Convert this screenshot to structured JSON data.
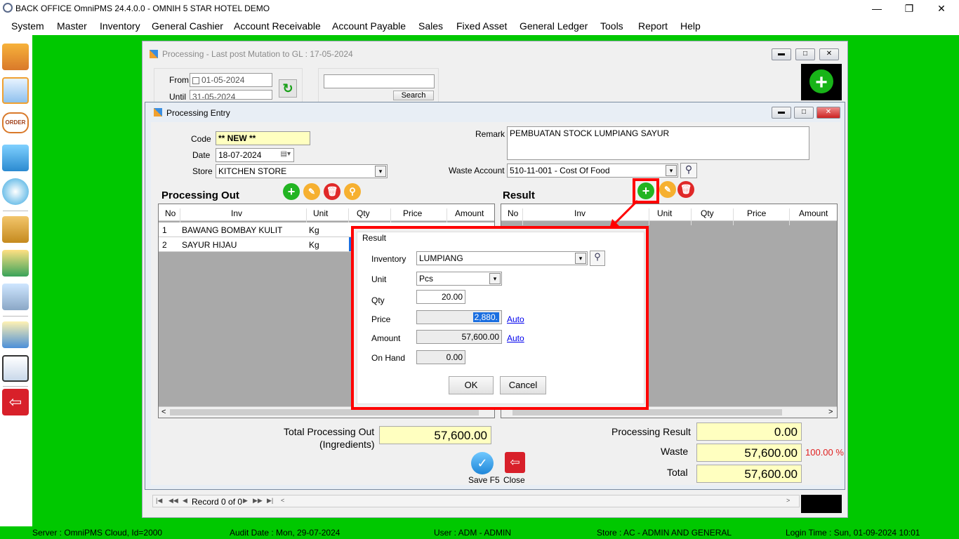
{
  "app": {
    "title": "BACK OFFICE OmniPMS 24.4.0.0 - OMNIH 5 STAR HOTEL DEMO",
    "menu": [
      "System",
      "Master",
      "Inventory",
      "General Cashier",
      "Account Receivable",
      "Account Payable",
      "Sales",
      "Fixed Asset",
      "General Ledger",
      "Tools",
      "Report",
      "Help"
    ]
  },
  "processing_window": {
    "title": "Processing - Last post Mutation to GL : 17-05-2024",
    "from_label": "From",
    "from_date": "01-05-2024",
    "until_label": "Until",
    "until_date": "31-05-2024",
    "search_label": "Search",
    "record_nav": "Record 0 of 0"
  },
  "entry": {
    "title": "Processing Entry",
    "code_label": "Code",
    "code_value": "** NEW **",
    "date_label": "Date",
    "date_value": "18-07-2024",
    "store_label": "Store",
    "store_value": "KITCHEN STORE",
    "remark_label": "Remark",
    "remark_value": "PEMBUATAN STOCK LUMPIANG SAYUR",
    "waste_account_label": "Waste Account",
    "waste_account_value": "510-11-001 - Cost Of Food",
    "processing_out_title": "Processing Out",
    "result_title": "Result",
    "columns": [
      "No",
      "Inv",
      "Unit",
      "Qty",
      "Price",
      "Amount"
    ],
    "out_rows": [
      {
        "no": "1",
        "inv": "BAWANG BOMBAY KULIT",
        "unit": "Kg"
      },
      {
        "no": "2",
        "inv": "SAYUR HIJAU",
        "unit": "Kg"
      }
    ],
    "total_out_label_1": "Total Processing Out",
    "total_out_label_2": "(Ingredients)",
    "total_out_value": "57,600.00",
    "processing_result_label": "Processing Result",
    "processing_result_value": "0.00",
    "waste_label": "Waste",
    "waste_value": "57,600.00",
    "waste_pct": "100.00 %",
    "total_label": "Total",
    "total_value": "57,600.00",
    "save_label": "Save F5",
    "close_label": "Close"
  },
  "result_dialog": {
    "group_title": "Result",
    "inventory_label": "Inventory",
    "inventory_value": "LUMPIANG",
    "unit_label": "Unit",
    "unit_value": "Pcs",
    "qty_label": "Qty",
    "qty_value": "20.00",
    "price_label": "Price",
    "price_value": "2,880.",
    "amount_label": "Amount",
    "amount_value": "57,600.00",
    "onhand_label": "On Hand",
    "onhand_value": "0.00",
    "auto_label": "Auto",
    "ok_label": "OK",
    "cancel_label": "Cancel"
  },
  "status": {
    "server": "Server : OmniPMS Cloud, Id=2000",
    "audit": "Audit Date : Mon, 29-07-2024",
    "user": "User : ADM - ADMIN",
    "store": "Store : AC - ADMIN AND GENERAL",
    "login": "Login Time : Sun, 01-09-2024 10:01"
  },
  "colors": {
    "green": "#00c800",
    "highlight": "#ff0000",
    "yellow_field": "#ffffc0"
  }
}
